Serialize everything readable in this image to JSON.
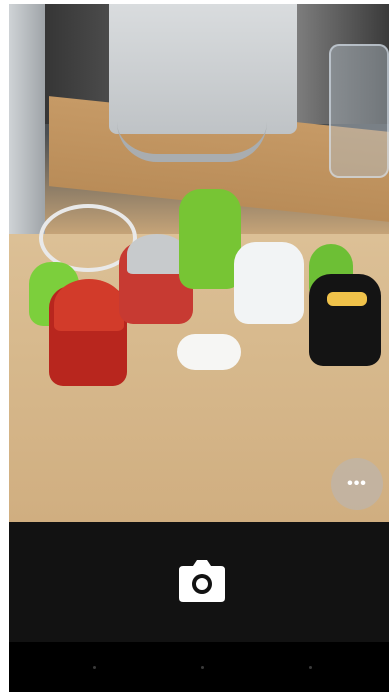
{
  "viewfinder": {
    "description_icon": "camera-preview"
  },
  "controls": {
    "more_icon_glyph": "•••",
    "shutter_icon": "camera-icon"
  },
  "colors": {
    "bar": "#121212",
    "nav": "#000000"
  }
}
